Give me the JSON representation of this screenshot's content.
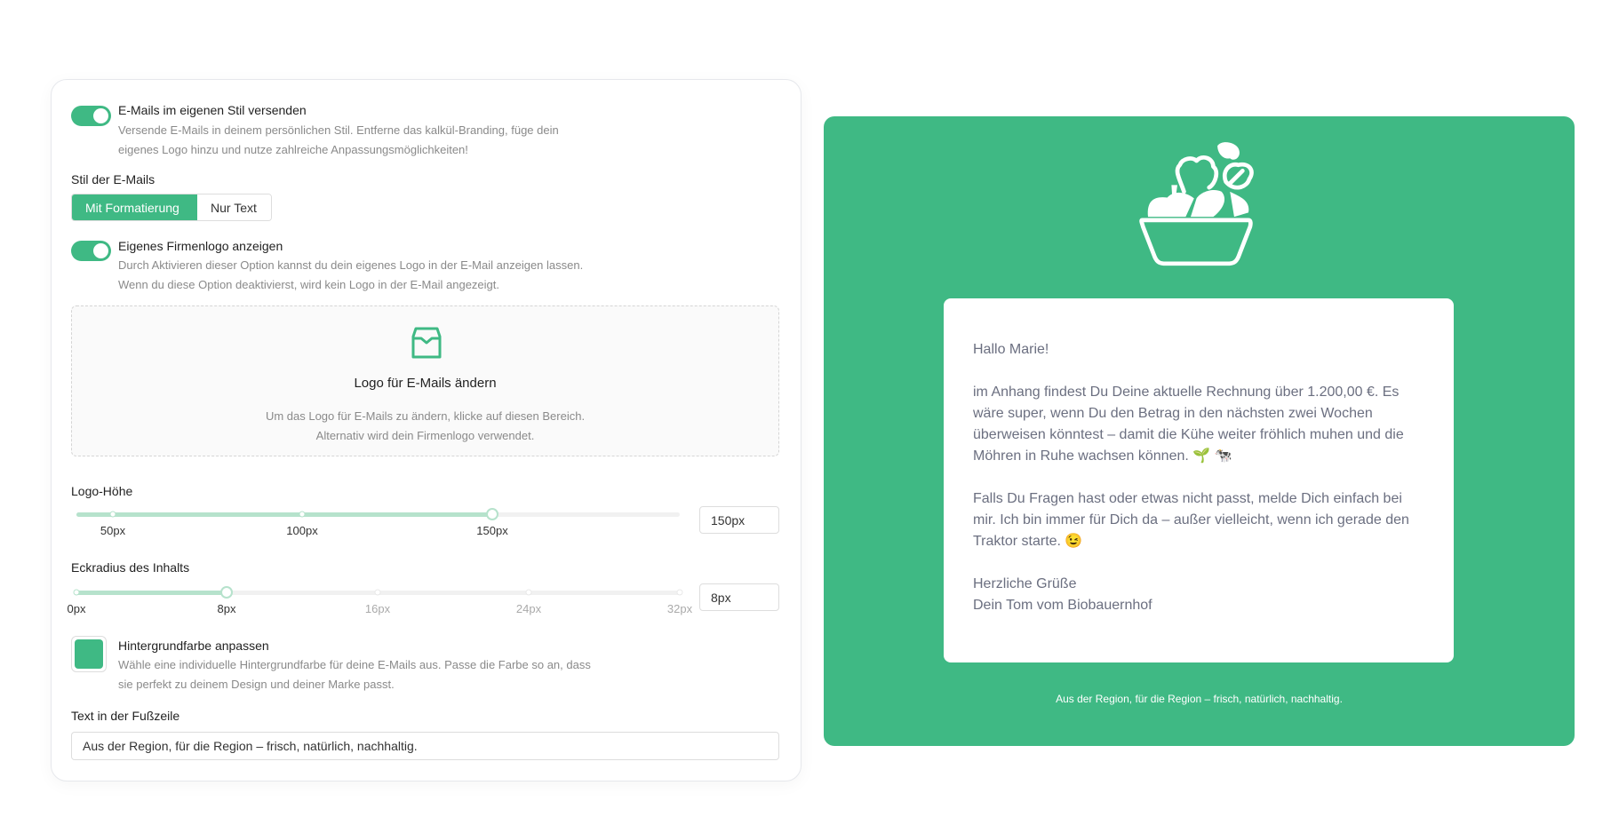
{
  "settings": {
    "own_style": {
      "title": "E-Mails im eigenen Stil versenden",
      "desc1": "Versende E-Mails in deinem persönlichen Stil. Entferne das kalkül-Branding, füge dein",
      "desc2": "eigenes Logo hinzu und nutze zahlreiche Anpassungsmöglichkeiten!",
      "enabled": true
    },
    "style": {
      "label": "Stil der E-Mails",
      "options": [
        "Mit Formatierung",
        "Nur Text"
      ],
      "selected": "Mit Formatierung"
    },
    "logo_toggle": {
      "title": "Eigenes Firmenlogo anzeigen",
      "desc1": "Durch Aktivieren dieser Option kannst du dein eigenes Logo in der E-Mail anzeigen lassen.",
      "desc2": "Wenn du diese Option deaktivierst, wird kein Logo in der E-Mail angezeigt.",
      "enabled": true
    },
    "dropzone": {
      "icon": "inbox-icon",
      "title": "Logo für E-Mails ändern",
      "desc1": "Um das Logo für E-Mails zu ändern, klicke auf diesen Bereich.",
      "desc2": "Alternativ wird dein Firmenlogo verwendet."
    },
    "logo_height": {
      "label": "Logo-Höhe",
      "ticks": [
        "50px",
        "100px",
        "150px"
      ],
      "value": "150px",
      "min": 50,
      "max": 150
    },
    "radius": {
      "label": "Eckradius des Inhalts",
      "ticks": [
        "0px",
        "8px",
        "16px",
        "24px",
        "32px"
      ],
      "value": "8px",
      "min": 0,
      "max": 32
    },
    "bg_color": {
      "title": "Hintergrundfarbe anpassen",
      "desc1": "Wähle eine individuelle Hintergrundfarbe für deine E-Mails aus. Passe die Farbe so an, dass",
      "desc2": "sie perfekt zu deinem Design und deiner Marke passt.",
      "color": "#3fb984"
    },
    "footer": {
      "label": "Text in der Fußzeile",
      "value": "Aus der Region, für die Region – frisch, natürlich, nachhaltig."
    }
  },
  "preview": {
    "logo_icon": "salad-bowl-icon",
    "greeting": "Hallo Marie!",
    "para1": "im Anhang findest Du Deine aktuelle Rechnung über 1.200,00 €. Es wäre super, wenn Du den Betrag in den nächsten zwei Wochen überweisen könntest – damit die Kühe weiter fröhlich muhen und die Möhren in Ruhe wachsen können. 🌱 🐄",
    "para2": "Falls Du Fragen hast oder etwas nicht passt, melde Dich einfach bei mir. Ich bin immer für Dich da – außer vielleicht, wenn ich gerade den Traktor starte. 😉",
    "closing1": "Herzliche Grüße",
    "closing2": "Dein Tom vom Biobauernhof",
    "footer": "Aus der Region, für die Region – frisch, natürlich, nachhaltig."
  },
  "colors": {
    "accent": "#3fb984"
  }
}
